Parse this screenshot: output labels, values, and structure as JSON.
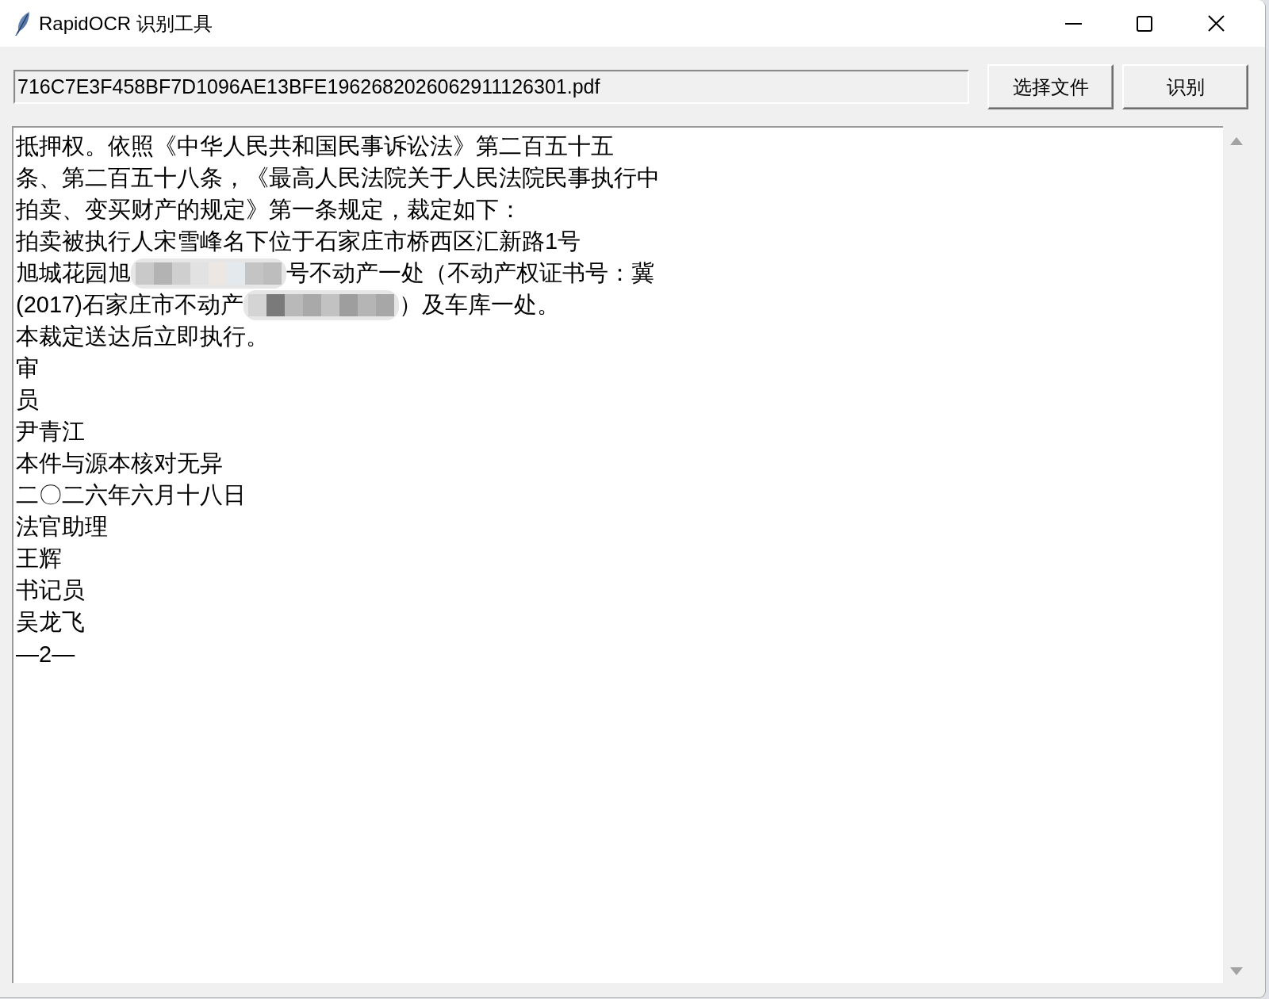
{
  "window": {
    "title": "RapidOCR 识别工具"
  },
  "file_path": {
    "value": "716C7E3F458BF7D1096AE13BFE1962682026062911126301.pdf"
  },
  "buttons": [
    "选择文件",
    "识别"
  ],
  "result_text": {
    "lines": [
      {
        "parts": [
          {
            "kind": "text",
            "text": "抵押权。依照《中华人民共和国民事诉讼法》第二百五十五"
          }
        ]
      },
      {
        "parts": [
          {
            "kind": "text",
            "text": "条、第二百五十八条，《最高人民法院关于人民法院民事执行中"
          }
        ]
      },
      {
        "parts": [
          {
            "kind": "text",
            "text": "拍卖、变买财产的规定》第一条规定，裁定如下："
          }
        ]
      },
      {
        "parts": [
          {
            "kind": "text",
            "text": "拍卖被执行人宋雪峰名下位于石家庄市桥西区汇新路1号"
          }
        ]
      },
      {
        "parts": [
          {
            "kind": "text",
            "text": "旭城花园旭"
          },
          {
            "kind": "redacted"
          },
          {
            "kind": "text",
            "text": "号不动产一处（不动产权证书号：冀"
          }
        ]
      },
      {
        "parts": [
          {
            "kind": "text",
            "text": "(2017)石家庄市不动产"
          },
          {
            "kind": "redacted"
          },
          {
            "kind": "text",
            "text": "）及车库一处。"
          }
        ]
      },
      {
        "parts": [
          {
            "kind": "text",
            "text": "本裁定送达后立即执行。"
          }
        ]
      },
      {
        "parts": [
          {
            "kind": "text",
            "text": "审"
          }
        ]
      },
      {
        "parts": [
          {
            "kind": "text",
            "text": "员"
          }
        ]
      },
      {
        "parts": [
          {
            "kind": "text",
            "text": "尹青江"
          }
        ]
      },
      {
        "parts": [
          {
            "kind": "text",
            "text": "本件与源本核对无异"
          }
        ]
      },
      {
        "parts": [
          {
            "kind": "text",
            "text": "二〇二六年六月十八日"
          }
        ]
      },
      {
        "parts": [
          {
            "kind": "text",
            "text": "法官助理"
          }
        ]
      },
      {
        "parts": [
          {
            "kind": "text",
            "text": "王辉"
          }
        ]
      },
      {
        "parts": [
          {
            "kind": "text",
            "text": "书记员"
          }
        ]
      },
      {
        "parts": [
          {
            "kind": "text",
            "text": "吴龙飞"
          }
        ]
      },
      {
        "parts": [
          {
            "kind": "text",
            "text": "—2—"
          }
        ]
      }
    ]
  }
}
